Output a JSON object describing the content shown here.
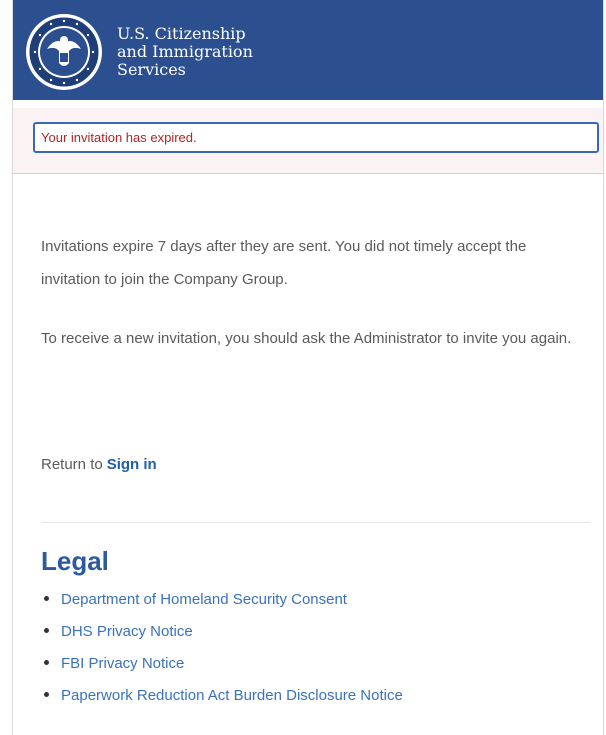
{
  "header": {
    "logo_icon": "dhs-seal-icon",
    "agency_line1": "U.S. Citizenship",
    "agency_line2": "and Immigration",
    "agency_line3": "Services",
    "background_color": "#2b4f8f"
  },
  "alert": {
    "message": "Your invitation has expired.",
    "text_color": "#b02525"
  },
  "body": {
    "paragraph1": "Invitations expire 7 days after they are sent. You did not timely accept the invitation to join the Company Group.",
    "paragraph2": "To receive a new invitation, you should ask the Administrator to invite you again.",
    "return_prefix": "Return to",
    "sign_in_link": "Sign in"
  },
  "legal": {
    "title": "Legal",
    "links": [
      "Department of Homeland Security Consent",
      "DHS Privacy Notice",
      "FBI Privacy Notice",
      "Paperwork Reduction Act Burden Disclosure Notice"
    ]
  }
}
